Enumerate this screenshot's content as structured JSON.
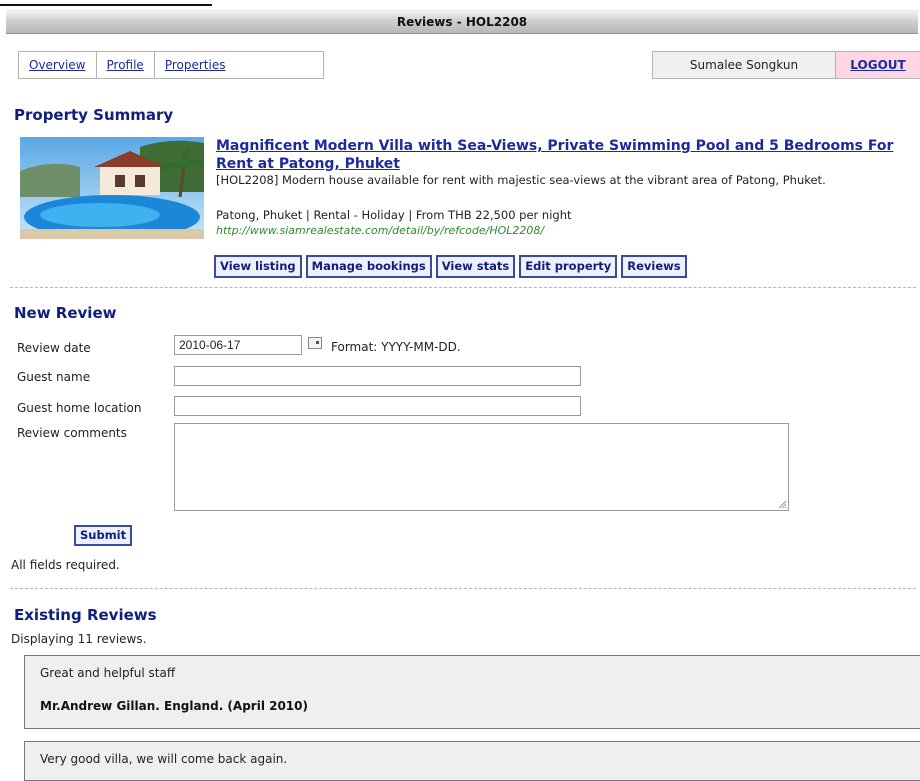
{
  "window": {
    "title": "Reviews - HOL2208"
  },
  "nav": {
    "links": [
      "Overview",
      "Profile",
      "Properties"
    ]
  },
  "user": {
    "name": "Sumalee Songkun",
    "logout": "LOGOUT"
  },
  "summary": {
    "heading": "Property Summary",
    "title": "Magnificent Modern Villa with Sea-Views, Private Swimming Pool and 5 Bedrooms For Rent at Patong, Phuket",
    "description": "[HOL2208] Modern house available for rent with majestic sea-views at the vibrant area of Patong, Phuket.",
    "meta": "Patong, Phuket | Rental - Holiday | From THB 22,500 per night",
    "url": "http://www.siamrealestate.com/detail/by/refcode/HOL2208/",
    "buttons": [
      "View listing",
      "Manage bookings",
      "View stats",
      "Edit property",
      "Reviews"
    ]
  },
  "form": {
    "heading": "New Review",
    "date_label": "Review date",
    "date_value": "2010-06-17",
    "date_format": "Format: YYYY-MM-DD.",
    "name_label": "Guest name",
    "location_label": "Guest home location",
    "comments_label": "Review comments",
    "submit": "Submit",
    "required_note": "All fields required."
  },
  "reviews": {
    "heading": "Existing Reviews",
    "count_text": "Displaying 11 reviews.",
    "items": [
      {
        "comment": "Great and helpful staff",
        "author": "Mr.Andrew Gillan. England. (April 2010)"
      },
      {
        "comment": "Very good villa, we will come back again.",
        "author": ""
      }
    ]
  },
  "colors": {
    "link": "#1b2b9c",
    "heading": "#10207a",
    "logout_bg": "#ffd6e2",
    "url": "#2e8b2e"
  }
}
